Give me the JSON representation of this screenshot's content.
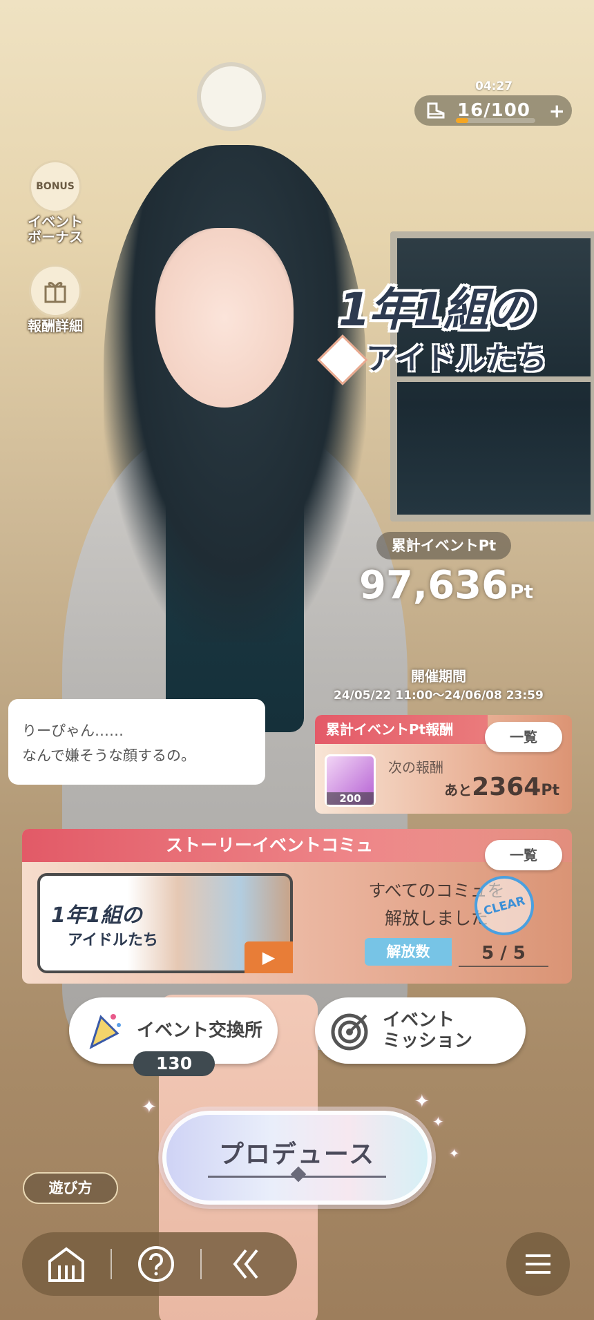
{
  "stamina": {
    "timer": "04:27",
    "count": "16/100",
    "plus_label": "+",
    "icon": "boot-icon",
    "fill_fraction": 0.16
  },
  "side": {
    "bonus_badge": "BONUS",
    "bonus_label": "イベント\nボーナス",
    "reward_label": "報酬詳細"
  },
  "logo": {
    "line1": "1年1組の",
    "line2": "アイドルたち"
  },
  "points": {
    "label": "累計イベントPt",
    "value": "97,636",
    "unit": "Pt"
  },
  "period": {
    "title": "開催期間",
    "range": "24/05/22 11:00〜24/06/08 23:59"
  },
  "dialogue": {
    "line1": "りーぴゃん……",
    "line2": "なんで嫌そうな顔するの。"
  },
  "reward": {
    "header": "累計イベントPt報酬",
    "list_label": "一覧",
    "item_count": "200",
    "next_label": "次の報酬",
    "remain_prefix": "あと",
    "remain_value": "2364",
    "remain_unit": "Pt"
  },
  "story": {
    "header": "ストーリーイベントコミュ",
    "list_label": "一覧",
    "thumb_title": "1年1組の",
    "thumb_sub": "アイドルたち",
    "message_line1": "すべてのコミュを",
    "message_line2": "解放しました",
    "clear_label": "CLEAR",
    "unlock_label": "解放数",
    "unlock_count": "5 / 5"
  },
  "exchange": {
    "label": "イベント交換所",
    "count": "130"
  },
  "mission": {
    "line1": "イベント",
    "line2": "ミッション"
  },
  "produce": {
    "label": "プロデュース"
  },
  "howto": {
    "label": "遊び方"
  },
  "colors": {
    "accent_red": "#e45a68",
    "panel_peach": "#eab49a",
    "badge_blue": "#77c4e6",
    "stamina_orange": "#f5a623"
  }
}
